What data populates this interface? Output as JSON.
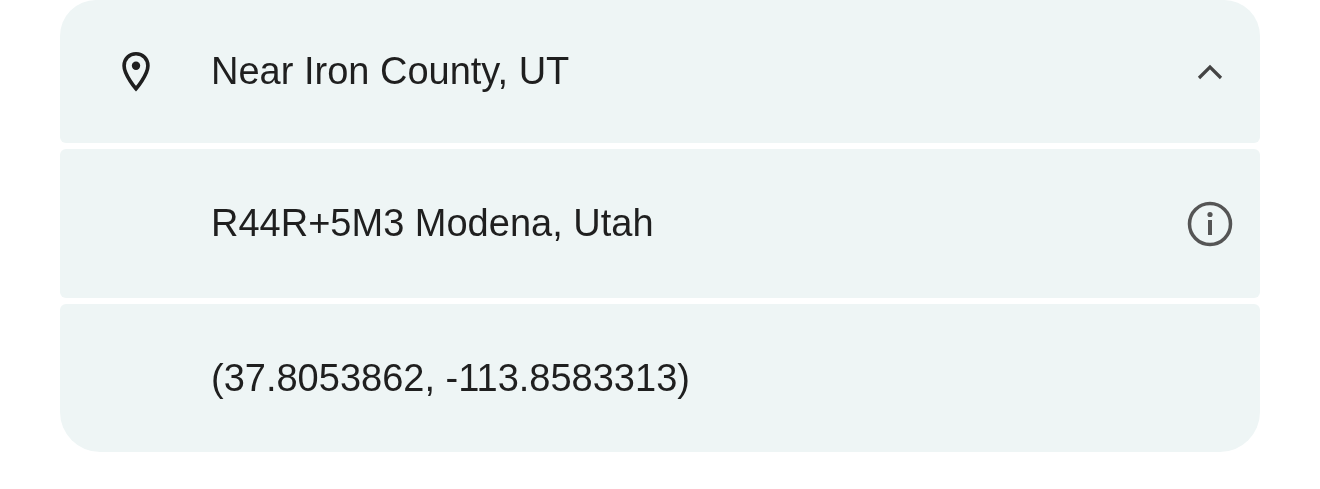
{
  "location": {
    "title": "Near Iron County, UT",
    "expanded": true
  },
  "details": [
    {
      "kind": "plus-code",
      "text": "R44R+5M3 Modena, Utah"
    },
    {
      "kind": "coordinates",
      "text": "(37.8053862, -113.8583313)"
    }
  ]
}
